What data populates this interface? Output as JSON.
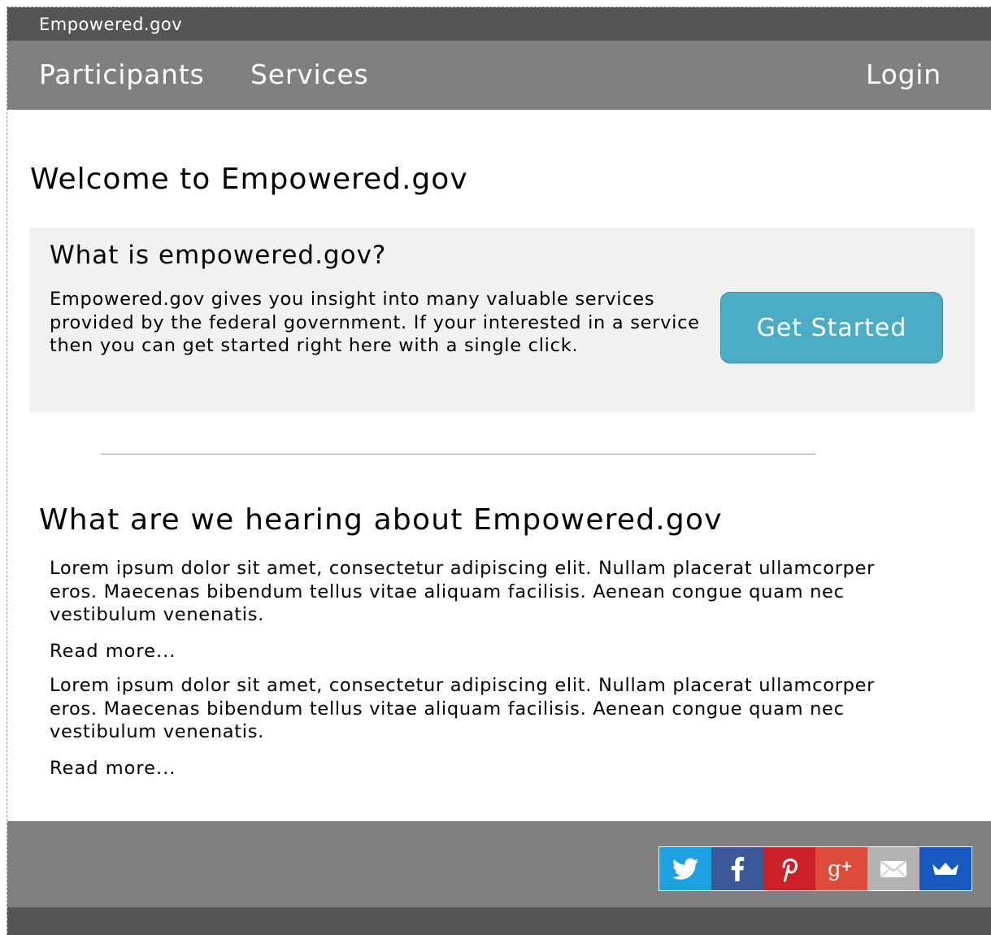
{
  "site": {
    "name": "Empowered.gov"
  },
  "nav": {
    "participants": "Participants",
    "services": "Services",
    "login": "Login"
  },
  "welcome_title": "Welcome to Empowered.gov",
  "intro": {
    "title": "What is empowered.gov?",
    "text": "Empowered.gov gives you insight into many valuable services provided by the federal government. If your interested in a service then you can get started right here with a single click.",
    "button_label": "Get Started"
  },
  "hearing": {
    "title": "What are we hearing about Empowered.gov",
    "items": [
      {
        "text": "Lorem ipsum dolor sit amet, consectetur adipiscing elit. Nullam placerat ullamcorper eros. Maecenas bibendum tellus vitae aliquam facilisis. Aenean congue quam nec vestibulum venenatis.",
        "link": "Read more..."
      },
      {
        "text": "Lorem ipsum dolor sit amet, consectetur adipiscing elit. Nullam placerat ullamcorper eros. Maecenas bibendum tellus vitae aliquam facilisis. Aenean congue quam nec vestibulum venenatis.",
        "link": "Read more..."
      }
    ]
  },
  "social": [
    {
      "icon": "twitter-icon",
      "color": "#1da1e2"
    },
    {
      "icon": "facebook-icon",
      "color": "#3b5998"
    },
    {
      "icon": "pinterest-icon",
      "color": "#cb2027"
    },
    {
      "icon": "google-plus-icon",
      "color": "#dd4b39"
    },
    {
      "icon": "email-icon",
      "color": "#b3b3b3"
    },
    {
      "icon": "crown-icon",
      "color": "#1759c0"
    }
  ],
  "colors": {
    "topbar": "#555555",
    "navbar": "#808080",
    "info_box": "#f1f1f1",
    "button": "#4bacc6"
  }
}
